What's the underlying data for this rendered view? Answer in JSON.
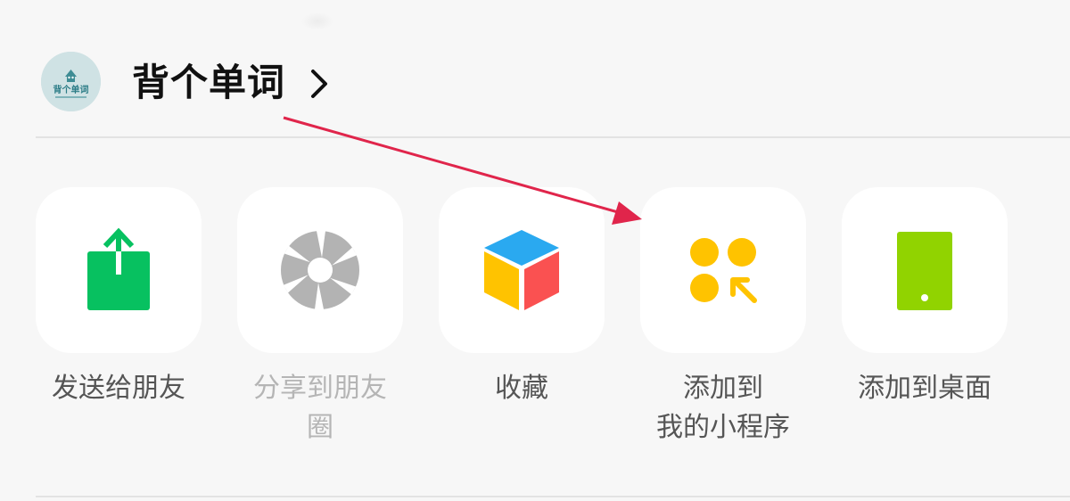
{
  "app": {
    "name": "背个单词",
    "icon": "app-logo-icon"
  },
  "actions": [
    {
      "label": "发送给朋友",
      "icon": "share-upload-icon",
      "enabled": true,
      "color": "#07C160"
    },
    {
      "label": "分享到朋友\n圈",
      "icon": "moments-shutter-icon",
      "enabled": false,
      "color": "#B3B3B3"
    },
    {
      "label": "收藏",
      "icon": "favorites-cube-icon",
      "enabled": true,
      "color": "#FFC300"
    },
    {
      "label": "添加到\n我的小程序",
      "icon": "my-miniprograms-icon",
      "enabled": true,
      "color": "#FFC300"
    },
    {
      "label": "添加到桌面",
      "icon": "add-to-desktop-icon",
      "enabled": true,
      "color": "#91D300"
    }
  ],
  "annotation": {
    "type": "arrow",
    "color": "#E0254B",
    "points_to": "添加到\n我的小程序"
  }
}
